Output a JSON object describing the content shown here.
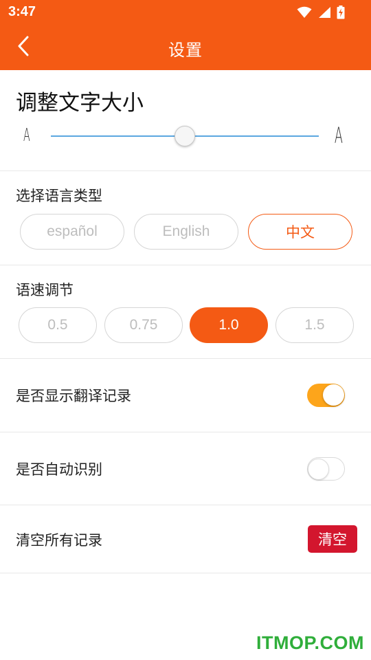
{
  "status_bar": {
    "time": "3:47",
    "icons": [
      "wifi-icon",
      "cell-signal-icon",
      "battery-charging-icon"
    ]
  },
  "app_bar": {
    "title": "设置",
    "back_icon": "chevron-left-icon"
  },
  "font_size": {
    "title": "调整文字大小",
    "small_glyph": "A",
    "large_glyph": "A",
    "value_fraction": 0.5
  },
  "language": {
    "label": "选择语言类型",
    "options": [
      "español",
      "English",
      "中文"
    ],
    "selected": "中文"
  },
  "speed": {
    "label": "语速调节",
    "options": [
      "0.5",
      "0.75",
      "1.0",
      "1.5"
    ],
    "selected": "1.0"
  },
  "show_history": {
    "label": "是否显示翻译记录",
    "enabled": true
  },
  "auto_detect": {
    "label": "是否自动识别",
    "enabled": false
  },
  "clear_records": {
    "label": "清空所有记录",
    "button_label": "清空"
  },
  "watermark": "ITMOP.COM",
  "colors": {
    "accent": "#f45a14",
    "toggle_on": "#fda51b",
    "danger": "#d3162e",
    "slider": "#5aa7e0",
    "watermark": "#2fae3a"
  }
}
